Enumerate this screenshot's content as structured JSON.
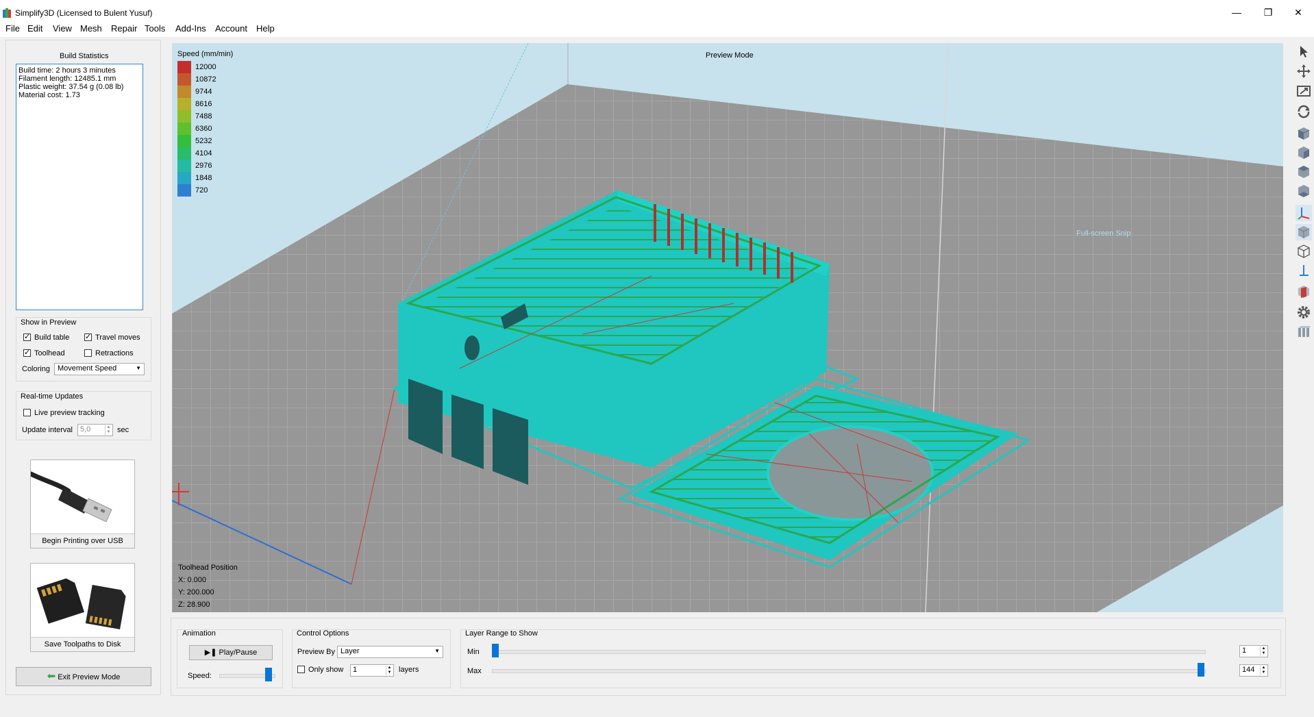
{
  "window": {
    "title": "Simplify3D (Licensed to Bulent Yusuf)",
    "controls": [
      "minimize-icon",
      "restore-icon",
      "close-icon"
    ]
  },
  "menu": [
    "File",
    "Edit",
    "View",
    "Mesh",
    "Repair",
    "Tools",
    "Add-Ins",
    "Account",
    "Help"
  ],
  "build_stats": {
    "title": "Build Statistics",
    "lines": [
      "Build time: 2 hours 3 minutes",
      "Filament length: 12485.1 mm",
      "Plastic weight: 37.54 g (0.08 lb)",
      "Material cost: 1.73"
    ]
  },
  "show_in_preview": {
    "title": "Show in Preview",
    "build_table": {
      "label": "Build table",
      "checked": true
    },
    "travel_moves": {
      "label": "Travel moves",
      "checked": true
    },
    "toolhead": {
      "label": "Toolhead",
      "checked": true
    },
    "retractions": {
      "label": "Retractions",
      "checked": false
    },
    "coloring_label": "Coloring",
    "coloring_value": "Movement Speed"
  },
  "realtime": {
    "title": "Real-time Updates",
    "live_label": "Live preview tracking",
    "live_checked": false,
    "interval_label": "Update interval",
    "interval_value": "5,0",
    "interval_unit": "sec"
  },
  "actions": {
    "usb_label": "Begin Printing over USB",
    "sd_label": "Save Toolpaths to Disk",
    "exit_label": "Exit Preview Mode"
  },
  "viewport": {
    "mode_label": "Preview Mode",
    "legend_title": "Speed (mm/min)",
    "legend": [
      {
        "value": "12000",
        "color": "#c62d2d"
      },
      {
        "value": "10872",
        "color": "#c4582c"
      },
      {
        "value": "9744",
        "color": "#c18a2a"
      },
      {
        "value": "8616",
        "color": "#b6b02a"
      },
      {
        "value": "7488",
        "color": "#8fbe2b"
      },
      {
        "value": "6360",
        "color": "#5fc02c"
      },
      {
        "value": "5232",
        "color": "#34bf3b"
      },
      {
        "value": "4104",
        "color": "#27bd6a"
      },
      {
        "value": "2976",
        "color": "#25bba0"
      },
      {
        "value": "1848",
        "color": "#26a8c4"
      },
      {
        "value": "720",
        "color": "#2e7fd1"
      }
    ],
    "toolhead_title": "Toolhead Position",
    "toolhead_x": "X: 0.000",
    "toolhead_y": "Y: 200.000",
    "toolhead_z": "Z: 28.900",
    "faint_overlay": "Full-screen Snip"
  },
  "animation": {
    "title": "Animation",
    "play_label": "Play/Pause",
    "speed_label": "Speed:",
    "speed_level": 0.9
  },
  "control_options": {
    "title": "Control Options",
    "preview_by_label": "Preview By",
    "preview_by_value": "Layer",
    "only_show_label": "Only show",
    "only_show_checked": false,
    "only_show_value": "1",
    "layers_label": "layers"
  },
  "layer_range": {
    "title": "Layer Range to Show",
    "min_label": "Min",
    "max_label": "Max",
    "min_value": "1",
    "max_value": "144",
    "total_layers": 144
  },
  "right_toolbar": [
    "select-cursor-icon",
    "move-icon",
    "scale-icon",
    "rotate-icon",
    "cube-view-front-icon",
    "cube-view-back-icon",
    "cube-view-left-icon",
    "cube-view-right-icon",
    "axes-icon",
    "solid-cube-icon",
    "wireframe-cube-icon",
    "axis-down-icon",
    "cross-section-icon",
    "settings-gear-icon",
    "layers-icon"
  ]
}
